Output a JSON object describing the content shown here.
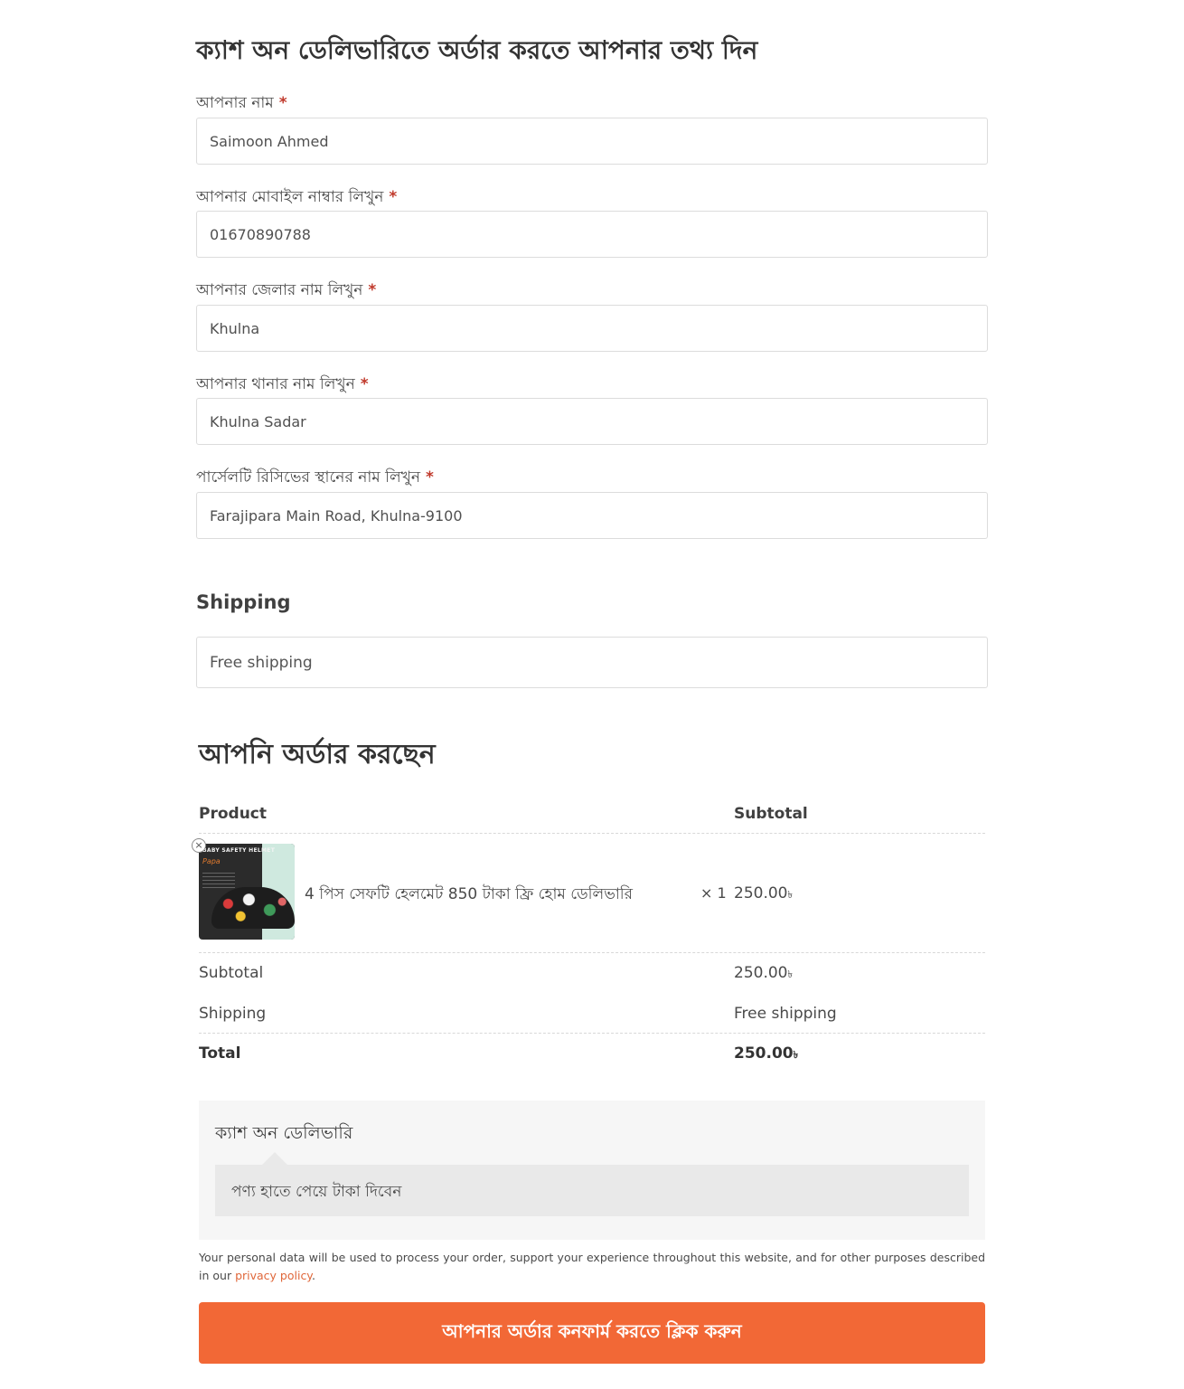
{
  "form": {
    "title": "ক্যাশ অন ডেলিভারিতে অর্ডার করতে আপনার তথ্য দিন",
    "required_mark": "*",
    "fields": [
      {
        "label": "আপনার নাম",
        "value": "Saimoon Ahmed"
      },
      {
        "label": "আপনার মোবাইল নাম্বার লিখুন",
        "value": "01670890788"
      },
      {
        "label": "আপনার জেলার নাম লিখুন",
        "value": "Khulna"
      },
      {
        "label": "আপনার থানার নাম লিখুন",
        "value": "Khulna Sadar"
      },
      {
        "label": "পার্সেলটি রিসিভের স্থানের নাম লিখুন",
        "value": "Farajipara Main Road, Khulna-9100"
      }
    ]
  },
  "shipping": {
    "heading": "Shipping",
    "method": "Free shipping"
  },
  "order": {
    "heading": "আপনি অর্ডার করছেন",
    "columns": {
      "product": "Product",
      "subtotal": "Subtotal"
    },
    "item": {
      "image_label": "BABY SAFETY HELMET",
      "image_brand": "Papa",
      "name": "4 পিস সেফটি হেলমেট 850 টাকা ফ্রি হোম ডেলিভারি",
      "quantity": "× 1",
      "subtotal": "250.00",
      "remove_symbol": "×"
    },
    "currency_symbol": "৳",
    "totals": {
      "subtotal_label": "Subtotal",
      "subtotal_value": "250.00",
      "shipping_label": "Shipping",
      "shipping_value": "Free shipping",
      "total_label": "Total",
      "total_value": "250.00"
    }
  },
  "payment": {
    "method_title": "ক্যাশ অন ডেলিভারি",
    "description": "পণ্য হাতে পেয়ে টাকা দিবেন"
  },
  "privacy": {
    "text": "Your personal data will be used to process your order, support your experience throughout this website, and for other purposes described in our",
    "link_text": "privacy policy",
    "suffix": "."
  },
  "confirm_button_label": "আপনার অর্ডার কনফার্ম করতে ক্লিক করুন",
  "colors": {
    "accent": "#f26836",
    "link": "#e0673a",
    "required": "#c0392b"
  }
}
